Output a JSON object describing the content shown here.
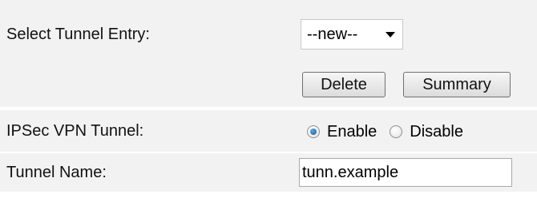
{
  "form": {
    "select_tunnel_entry": {
      "label": "Select Tunnel Entry:",
      "selected": "--new--"
    },
    "buttons": {
      "delete_label": "Delete",
      "summary_label": "Summary"
    },
    "ipsec_vpn_tunnel": {
      "label": "IPSec VPN Tunnel:",
      "options": [
        {
          "label": "Enable",
          "checked": true
        },
        {
          "label": "Disable",
          "checked": false
        }
      ]
    },
    "tunnel_name": {
      "label": "Tunnel Name:",
      "value": "tunn.example"
    }
  },
  "colors": {
    "row_background": "#f2f2f2",
    "radio_selected": "#1d5c98"
  }
}
